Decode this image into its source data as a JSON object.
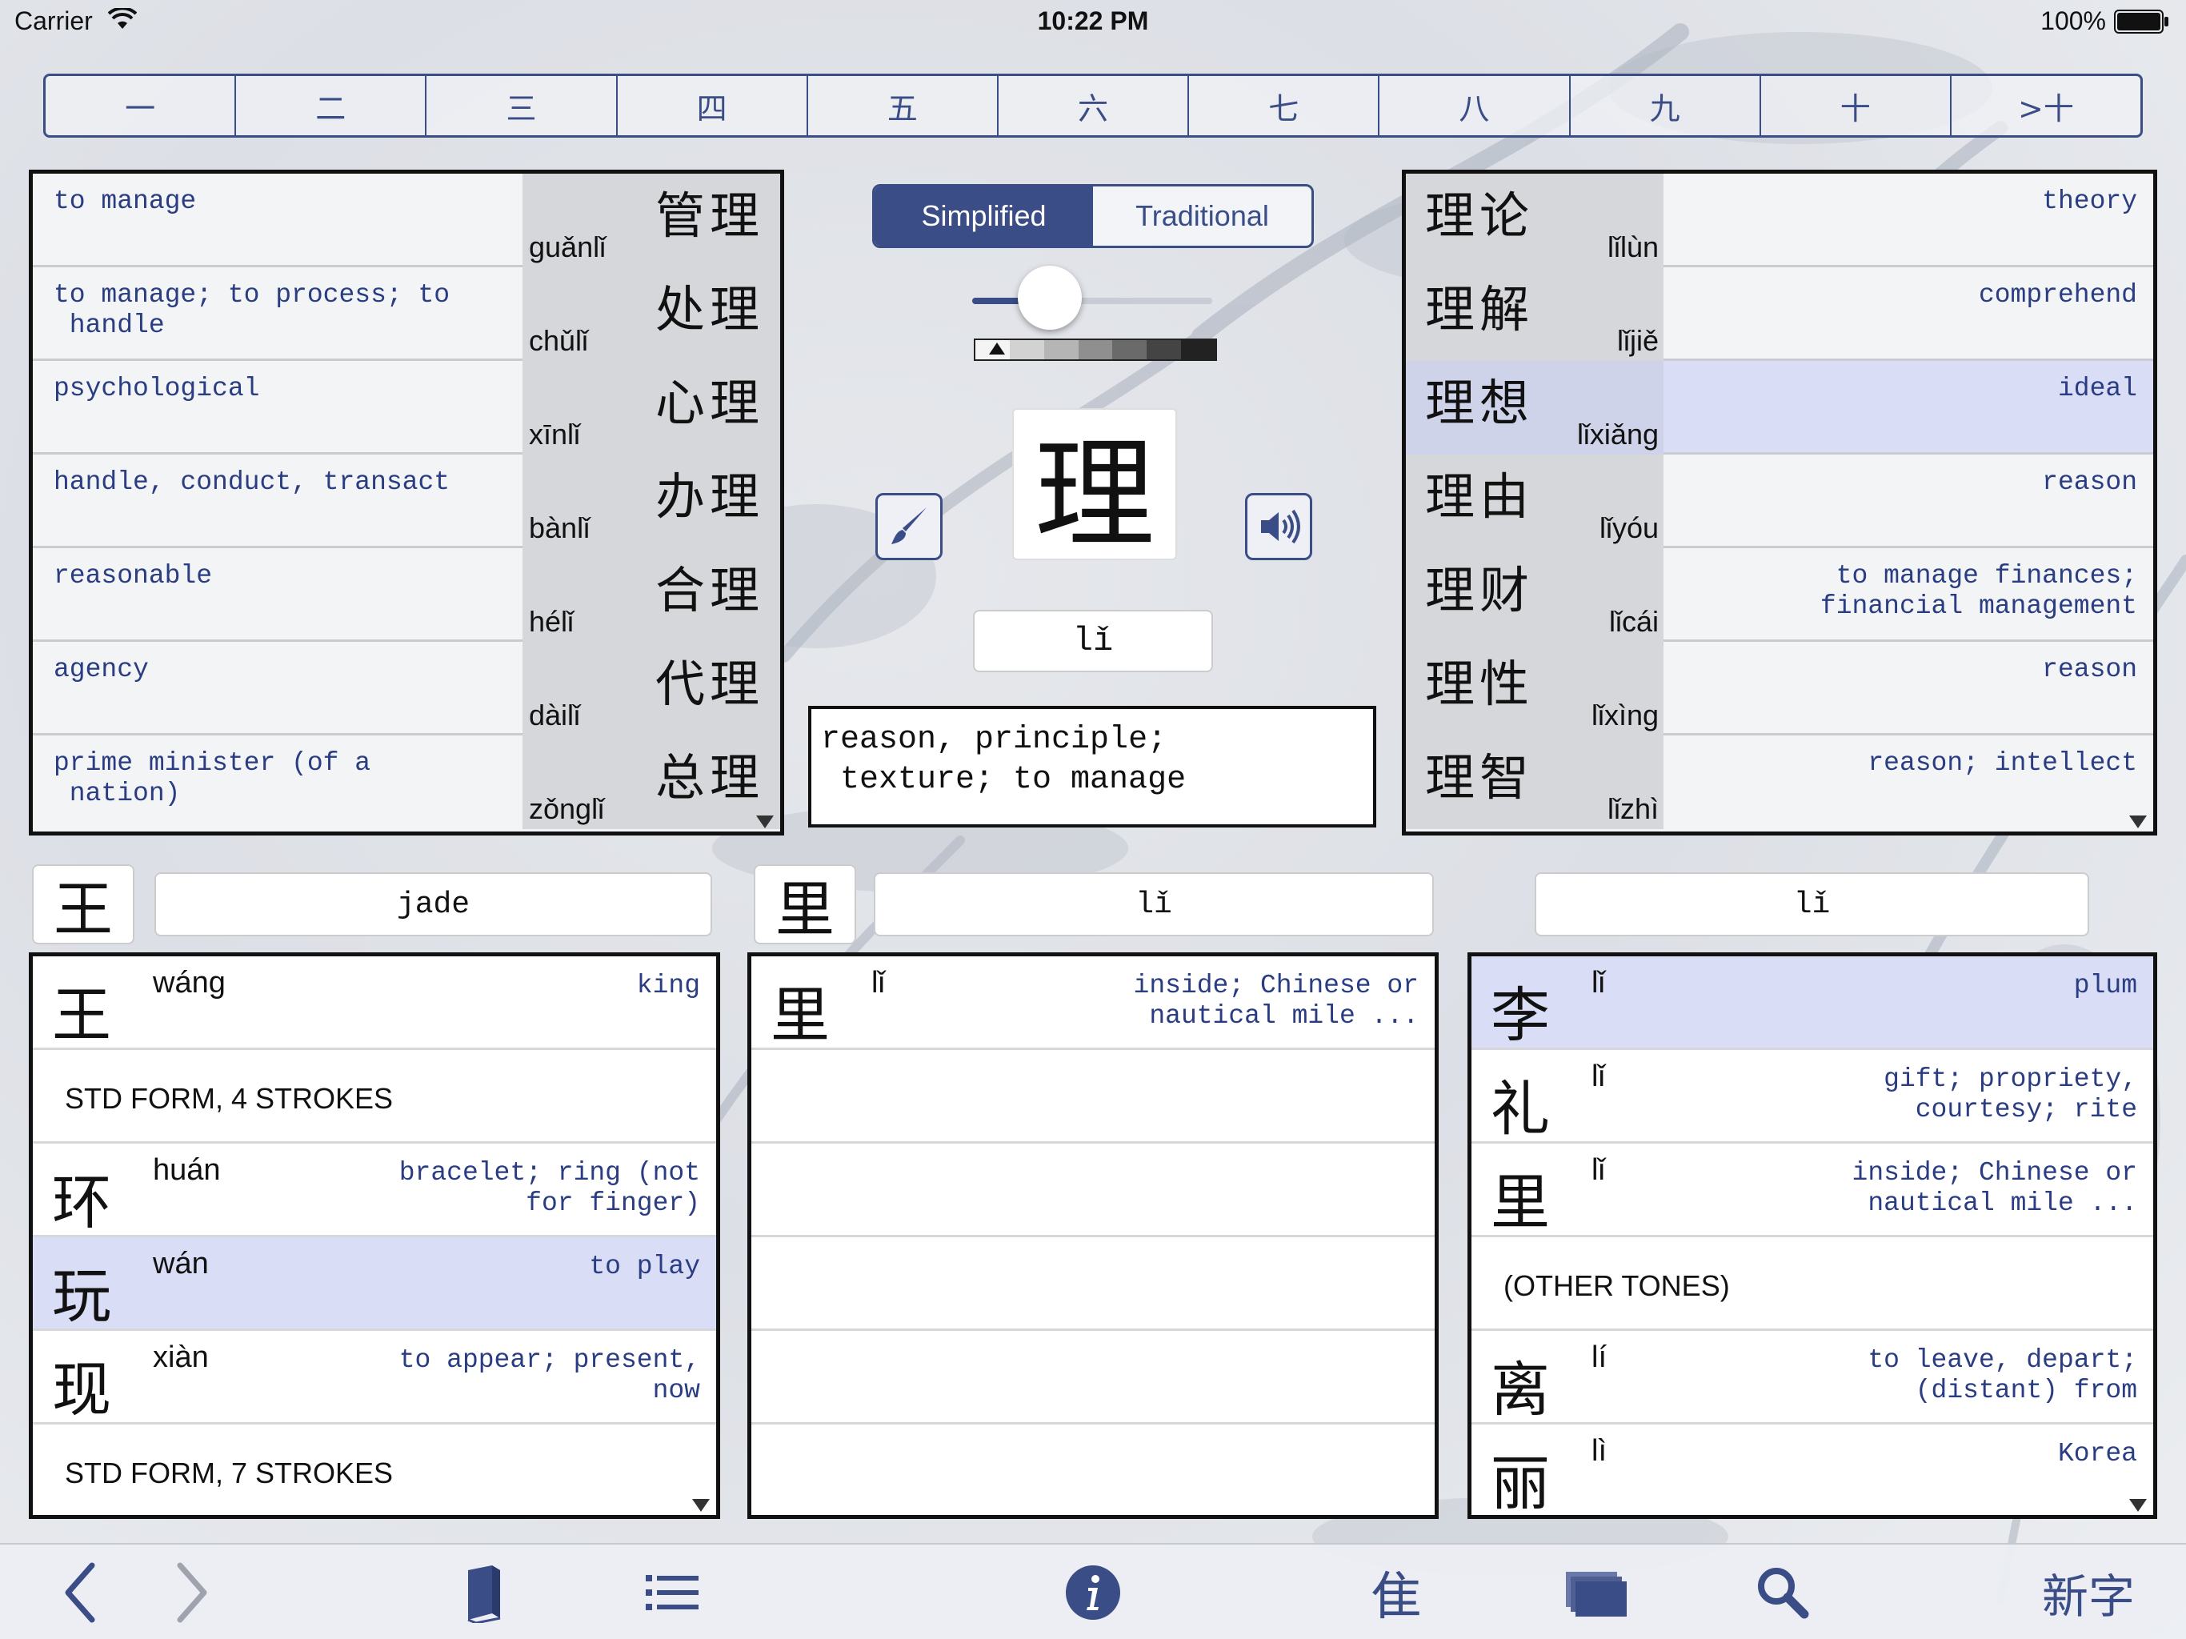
{
  "status_bar": {
    "carrier": "Carrier",
    "time": "10:22 PM",
    "battery": "100%"
  },
  "level_tabs": [
    "一",
    "二",
    "三",
    "四",
    "五",
    "六",
    "七",
    "八",
    "九",
    "十",
    ">十"
  ],
  "script_toggle": {
    "simplified": "Simplified",
    "traditional": "Traditional",
    "selected": "Simplified"
  },
  "main_character": {
    "hanzi": "理",
    "pinyin": "lǐ",
    "definition_line1": "reason, principle;",
    "definition_line2": "texture; to manage"
  },
  "left_words": [
    {
      "hanzi": "管理",
      "pinyin": "guǎnlǐ",
      "def1": "to manage",
      "def2": ""
    },
    {
      "hanzi": "处理",
      "pinyin": "chǔlǐ",
      "def1": "to manage; to process; to",
      "def2": " handle"
    },
    {
      "hanzi": "心理",
      "pinyin": "xīnlǐ",
      "def1": "psychological",
      "def2": ""
    },
    {
      "hanzi": "办理",
      "pinyin": "bànlǐ",
      "def1": "handle, conduct, transact",
      "def2": ""
    },
    {
      "hanzi": "合理",
      "pinyin": "hélǐ",
      "def1": "reasonable",
      "def2": ""
    },
    {
      "hanzi": "代理",
      "pinyin": "dàilǐ",
      "def1": "agency",
      "def2": ""
    },
    {
      "hanzi": "总理",
      "pinyin": "zǒnglǐ",
      "def1": "prime minister (of a",
      "def2": " nation)"
    }
  ],
  "right_words": [
    {
      "hanzi": "理论",
      "pinyin": "lǐlùn",
      "def1": "theory",
      "def2": ""
    },
    {
      "hanzi": "理解",
      "pinyin": "lǐjiě",
      "def1": "comprehend",
      "def2": ""
    },
    {
      "hanzi": "理想",
      "pinyin": "lǐxiǎng",
      "def1": "ideal",
      "def2": ""
    },
    {
      "hanzi": "理由",
      "pinyin": "lǐyóu",
      "def1": "reason",
      "def2": ""
    },
    {
      "hanzi": "理财",
      "pinyin": "lǐcái",
      "def1": "to manage finances;",
      "def2": "financial management"
    },
    {
      "hanzi": "理性",
      "pinyin": "lǐxìng",
      "def1": "reason",
      "def2": ""
    },
    {
      "hanzi": "理智",
      "pinyin": "lǐzhì",
      "def1": "reason; intellect",
      "def2": ""
    }
  ],
  "component1": {
    "hanzi": "王",
    "meaning": "jade"
  },
  "component2": {
    "hanzi": "里",
    "pinyin": "lǐ"
  },
  "sound_component": {
    "pinyin": "lǐ"
  },
  "list1": {
    "r0": {
      "hanzi": "王",
      "pinyin": "wáng",
      "def1": "king",
      "def2": ""
    },
    "section1": "STD FORM, 4 STROKES",
    "r2": {
      "hanzi": "环",
      "pinyin": "huán",
      "def1": "bracelet; ring (not",
      "def2": "for finger)"
    },
    "r3": {
      "hanzi": "玩",
      "pinyin": "wán",
      "def1": "to play",
      "def2": ""
    },
    "r4": {
      "hanzi": "现",
      "pinyin": "xiàn",
      "def1": "to appear; present,",
      "def2": "now"
    },
    "section2": "STD FORM, 7 STROKES"
  },
  "list2": {
    "r0": {
      "hanzi": "里",
      "pinyin": "lǐ",
      "def1": "inside; Chinese or",
      "def2": "nautical mile ..."
    }
  },
  "list3": {
    "r0": {
      "hanzi": "李",
      "pinyin": "lǐ",
      "def1": "plum",
      "def2": ""
    },
    "r1": {
      "hanzi": "礼",
      "pinyin": "lǐ",
      "def1": "gift; propriety,",
      "def2": "courtesy; rite"
    },
    "r2": {
      "hanzi": "里",
      "pinyin": "lǐ",
      "def1": "inside; Chinese or",
      "def2": "nautical mile ..."
    },
    "section": "(OTHER TONES)",
    "r4": {
      "hanzi": "离",
      "pinyin": "lí",
      "def1": "to leave, depart;",
      "def2": "(distant) from"
    },
    "r5": {
      "hanzi": "丽",
      "pinyin": "lì",
      "def1": "Korea",
      "def2": ""
    }
  },
  "toolbar": {
    "radical_glyph": "⾫",
    "new_chars_label": "新字"
  },
  "colors": {
    "accent": "#3b4d86",
    "highlight": "#d9ddf6",
    "definition_text": "#2a3c82"
  },
  "font_size_slider": {
    "value": 0.19
  },
  "icons": [
    "wifi-icon",
    "battery-icon",
    "brush-icon",
    "speaker-icon",
    "back-chevron-icon",
    "forward-chevron-icon",
    "book-icon",
    "list-icon",
    "info-icon",
    "cards-icon",
    "search-icon"
  ]
}
